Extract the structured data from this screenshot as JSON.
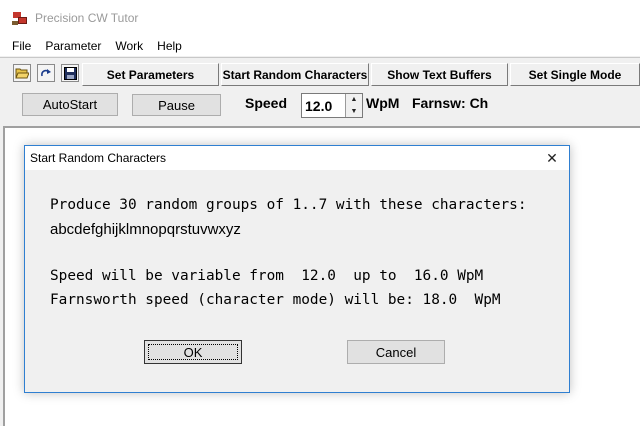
{
  "window": {
    "title": "Precision CW Tutor"
  },
  "menu": [
    "File",
    "Parameter",
    "Work",
    "Help"
  ],
  "toolbar": {
    "icons": [
      "open-folder-icon",
      "redo-arrow-icon",
      "save-disk-icon"
    ],
    "buttons": [
      "Set Parameters",
      "Start Random Characters",
      "Show Text Buffers",
      "Set Single Mode"
    ]
  },
  "controls": {
    "autostart_label": "AutoStart",
    "pause_label": "Pause",
    "speed_label": "Speed",
    "speed_value": "12.0",
    "speed_unit": "WpM",
    "farnsworth_label": "Farnsw: Ch"
  },
  "dialog": {
    "title": "Start Random Characters",
    "line1": "Produce 30 random groups of 1..7 with these characters:",
    "line2": "abcdefghijklmnopqrstuvwxyz",
    "line3": "Speed will be variable from  12.0  up to  16.0 WpM",
    "line4": "Farnsworth speed (character mode) will be: 18.0  WpM",
    "ok_label": "OK",
    "cancel_label": "Cancel"
  },
  "colors": {
    "dialog_border": "#2f7fd1",
    "title_text": "#9a9a9a"
  }
}
